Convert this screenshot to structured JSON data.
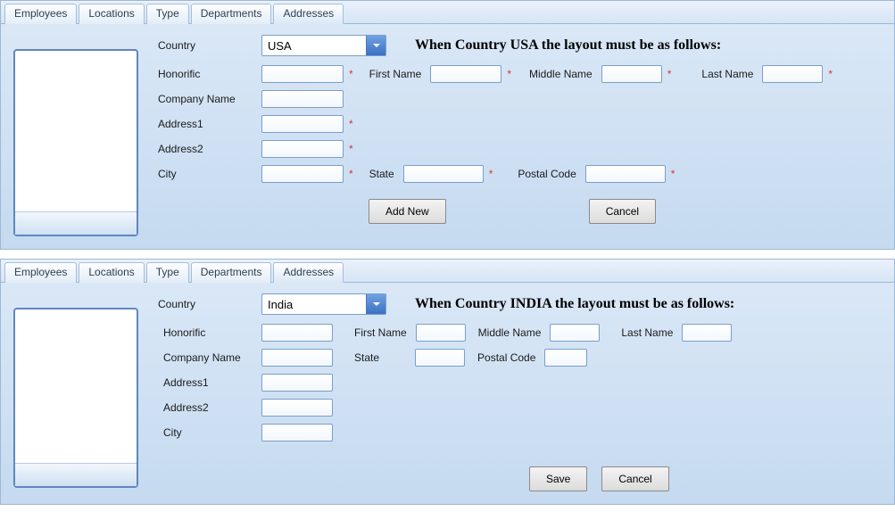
{
  "tabs": [
    "Employees",
    "Locations",
    "Type",
    "Departments",
    "Addresses"
  ],
  "activeTab": "Addresses",
  "top": {
    "countryLabel": "Country",
    "countryValue": "USA",
    "instruction": "When Country USA the layout must be as follows:",
    "labels": {
      "honorific": "Honorific",
      "firstName": "First Name",
      "middleName": "Middle Name",
      "lastName": "Last Name",
      "companyName": "Company Name",
      "address1": "Address1",
      "address2": "Address2",
      "city": "City",
      "state": "State",
      "postalCode": "Postal Code"
    },
    "buttons": {
      "addNew": "Add New",
      "cancel": "Cancel"
    },
    "listHeight": 210
  },
  "bottom": {
    "countryLabel": "Country",
    "countryValue": "India",
    "instruction": "When Country INDIA the layout must be as follows:",
    "labels": {
      "honorific": "Honorific",
      "firstName": "First Name",
      "middleName": "Middle Name",
      "lastName": "Last Name",
      "companyName": "Company Name",
      "address1": "Address1",
      "address2": "Address2",
      "city": "City",
      "state": "State",
      "postalCode": "Postal Code"
    },
    "buttons": {
      "save": "Save",
      "cancel": "Cancel"
    },
    "listHeight": 202
  },
  "requiredMark": "*"
}
